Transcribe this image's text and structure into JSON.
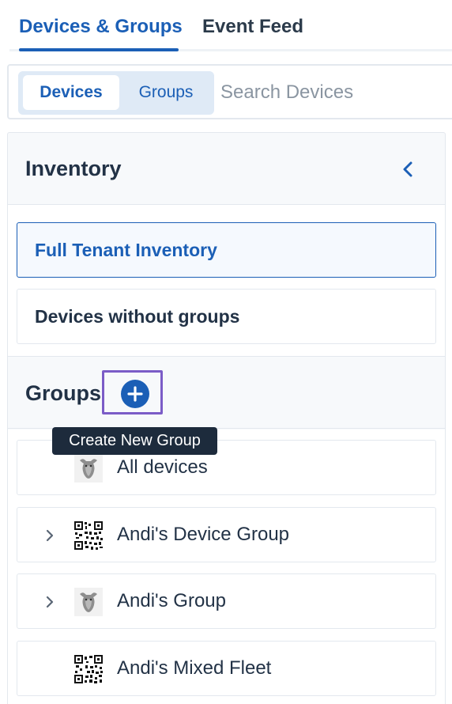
{
  "tabs": [
    {
      "label": "Devices & Groups",
      "active": true
    },
    {
      "label": "Event Feed",
      "active": false
    }
  ],
  "search": {
    "segments": [
      "Devices",
      "Groups"
    ],
    "selected": "Devices",
    "placeholder": "Search Devices"
  },
  "inventory": {
    "title": "Inventory",
    "items": [
      {
        "label": "Full Tenant Inventory",
        "selected": true
      },
      {
        "label": "Devices without groups",
        "selected": false
      }
    ]
  },
  "groups": {
    "title": "Groups",
    "add_icon": "plus-circle-icon",
    "tooltip": "Create New Group",
    "items": [
      {
        "label": "All devices",
        "icon": "goat-avatar-icon",
        "expandable": false
      },
      {
        "label": "Andi's Device Group",
        "icon": "qr-code-icon",
        "expandable": true
      },
      {
        "label": "Andi's Group",
        "icon": "goat-avatar-icon",
        "expandable": true
      },
      {
        "label": "Andi's Mixed Fleet",
        "icon": "qr-code-icon",
        "expandable": false
      }
    ]
  },
  "colors": {
    "accent": "#1b5fb6",
    "highlight": "#7b5cc7",
    "tooltip_bg": "#1d2b3c"
  }
}
